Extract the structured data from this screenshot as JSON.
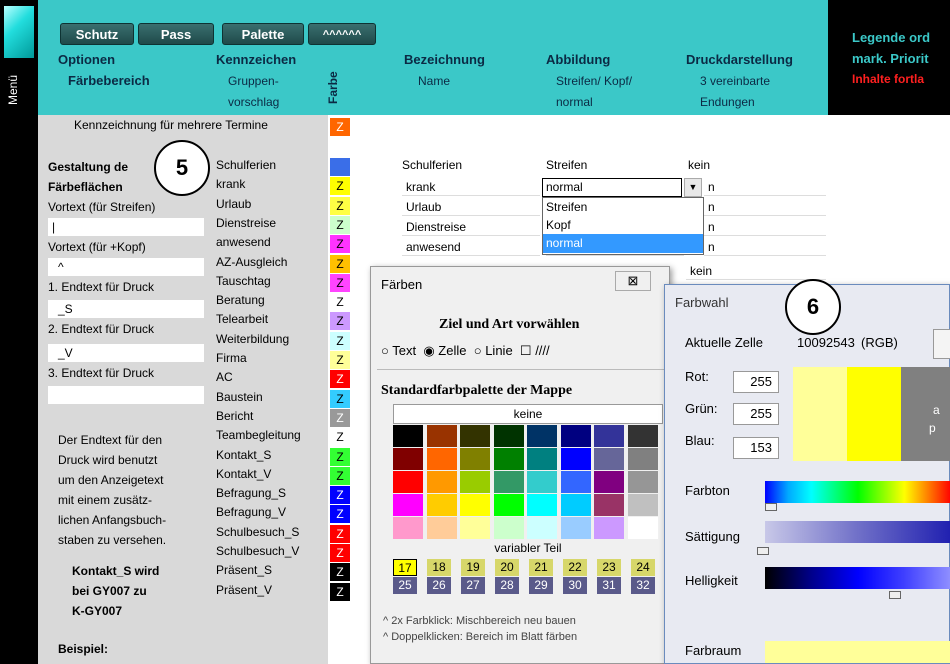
{
  "sidebar": {
    "menu_label": "Menü"
  },
  "toolbar": {
    "buttons": [
      "Schutz",
      "Pass",
      "Palette",
      "^^^^^^"
    ]
  },
  "header": {
    "optionen": "Optionen",
    "faerbebereich": "Färbebereich",
    "kennzeichen": "Kennzeichen",
    "gruppen": "Gruppen-",
    "vorschlag": "vorschlag",
    "farbe": "Farbe",
    "bezeichnung": "Bezeichnung",
    "name": "Name",
    "abbildung": "Abbildung",
    "streifen_kopf": "Streifen/ Kopf/",
    "normal": "normal",
    "druck": "Druckdarstellung",
    "vereinbarte": "3 vereinbarte",
    "endungen": "Endungen",
    "legende": "Legende ord",
    "prioritaet": "mark. Priorit",
    "inhalte": "Inhalte fortla"
  },
  "left": {
    "kennzeichnung": "Kennzeichnung für mehrere Termine",
    "gestaltung": "Gestaltung de",
    "faerbeflaechen": "Färbeflächen",
    "vortext_streifen": "Vortext (für Streifen)",
    "vortext_streifen_val": "|",
    "vortext_kopf": "Vortext (für +Kopf)",
    "vortext_kopf_val": "^",
    "endtext1": "1. Endtext für Druck",
    "endtext1_val": "_S",
    "endtext2": "2. Endtext für Druck",
    "endtext2_val": "_V",
    "endtext3": "3. Endtext für Druck",
    "endtext3_val": "",
    "desc": [
      "Der Endtext für den",
      "Druck wird benutzt",
      "um den Anzeigetext",
      "mit einem zusätz-",
      "lichen Anfangsbuch-",
      "staben zu versehen."
    ],
    "example1": "Kontakt_S wird",
    "example2": "bei GY007 zu",
    "example3": "K-GY007",
    "beispiel": "Beispiel:"
  },
  "groups": [
    {
      "name": "Schulferien",
      "z": "",
      "color": "#3a6ee8"
    },
    {
      "name": "krank",
      "z": "Z",
      "color": "#ffff00"
    },
    {
      "name": "Urlaub",
      "z": "Z",
      "color": "#ffff44"
    },
    {
      "name": "Dienstreise",
      "z": "Z",
      "color": "#ccffcc"
    },
    {
      "name": "anwesend",
      "z": "Z",
      "color": "#ff33ff"
    },
    {
      "name": "AZ-Ausgleich",
      "z": "Z",
      "color": "#ffc000"
    },
    {
      "name": "Tauschtag",
      "z": "Z",
      "color": "#ff44ff"
    },
    {
      "name": "Beratung",
      "z": "Z",
      "color": "#ffffff"
    },
    {
      "name": "Telearbeit",
      "z": "Z",
      "color": "#cc99ff"
    },
    {
      "name": "Weiterbildung",
      "z": "Z",
      "color": "#ccffff"
    },
    {
      "name": "Firma",
      "z": "Z",
      "color": "#ffff99"
    },
    {
      "name": "AC",
      "z": "Z",
      "color": "#ff0000"
    },
    {
      "name": "Baustein",
      "z": "Z",
      "color": "#33ccff"
    },
    {
      "name": "Bericht",
      "z": "Z",
      "color": "#999999"
    },
    {
      "name": "Teambegleitung",
      "z": "Z",
      "color": "#ffffff"
    },
    {
      "name": "Kontakt_S",
      "z": "Z",
      "color": "#33ff33"
    },
    {
      "name": "Kontakt_V",
      "z": "Z",
      "color": "#33ff33"
    },
    {
      "name": "Befragung_S",
      "z": "Z",
      "color": "#0000ff"
    },
    {
      "name": "Befragung_V",
      "z": "Z",
      "color": "#0000ff"
    },
    {
      "name": "Schulbesuch_S",
      "z": "Z",
      "color": "#ff0000"
    },
    {
      "name": "Schulbesuch_V",
      "z": "Z",
      "color": "#ff0000"
    },
    {
      "name": "Präsent_S",
      "z": "Z",
      "color": "#000000"
    },
    {
      "name": "Präsent_V",
      "z": "Z",
      "color": "#000000"
    }
  ],
  "kennz_z": "Z",
  "table": {
    "rows": [
      {
        "name": "Schulferien",
        "abb": "Streifen",
        "druck": "kein"
      },
      {
        "name": "krank",
        "abb": "normal",
        "druck": "n"
      },
      {
        "name": "Urlaub",
        "abb": "",
        "druck": "n"
      },
      {
        "name": "Dienstreise",
        "abb": "",
        "druck": "n"
      },
      {
        "name": "anwesend",
        "abb": "",
        "druck": "n"
      }
    ],
    "dropdown_options": [
      "Streifen",
      "Kopf",
      "normal"
    ],
    "kein2": "kein"
  },
  "circles": {
    "c5": "5",
    "c6": "6"
  },
  "faerben": {
    "title": "Färben",
    "close": "⊠",
    "ziel": "Ziel und Art vorwählen",
    "opt_text": "Text",
    "opt_zelle": "Zelle",
    "opt_linie": "Linie",
    "opt_extra": "////",
    "std": "Standardfarbpalette der Mappe",
    "keine": "keine",
    "variabler": "variabler Teil",
    "nums1": [
      "17",
      "18",
      "19",
      "20",
      "21",
      "22",
      "23",
      "24"
    ],
    "nums2": [
      "25",
      "26",
      "27",
      "28",
      "29",
      "30",
      "31",
      "32"
    ],
    "hint1": "^ 2x Farbklick: Mischbereich neu bauen",
    "hint2": "^ Doppelklicken: Bereich im Blatt färben",
    "palette": [
      [
        "#000000",
        "#993300",
        "#333300",
        "#003300",
        "#003366",
        "#000080",
        "#333399",
        "#333333"
      ],
      [
        "#800000",
        "#ff6600",
        "#808000",
        "#008000",
        "#008080",
        "#0000ff",
        "#666699",
        "#808080"
      ],
      [
        "#ff0000",
        "#ff9900",
        "#99cc00",
        "#339966",
        "#33cccc",
        "#3366ff",
        "#800080",
        "#969696"
      ],
      [
        "#ff00ff",
        "#ffcc00",
        "#ffff00",
        "#00ff00",
        "#00ffff",
        "#00ccff",
        "#993366",
        "#c0c0c0"
      ],
      [
        "#ff99cc",
        "#ffcc99",
        "#ffff99",
        "#ccffcc",
        "#ccffff",
        "#99ccff",
        "#cc99ff",
        "#ffffff"
      ]
    ]
  },
  "farbwahl": {
    "title": "Farbwahl",
    "aktuelle": "Aktuelle Zelle",
    "zellwert": "10092543",
    "rgb": "(RGB)",
    "rot": "Rot:",
    "rot_val": "255",
    "gruen": "Grün:",
    "gruen_val": "255",
    "blau": "Blau:",
    "blau_val": "153",
    "farbton": "Farbton",
    "saettigung": "Sättigung",
    "helligkeit": "Helligkeit",
    "farbraum": "Farbraum",
    "side_a": "a",
    "side_p": "p"
  }
}
